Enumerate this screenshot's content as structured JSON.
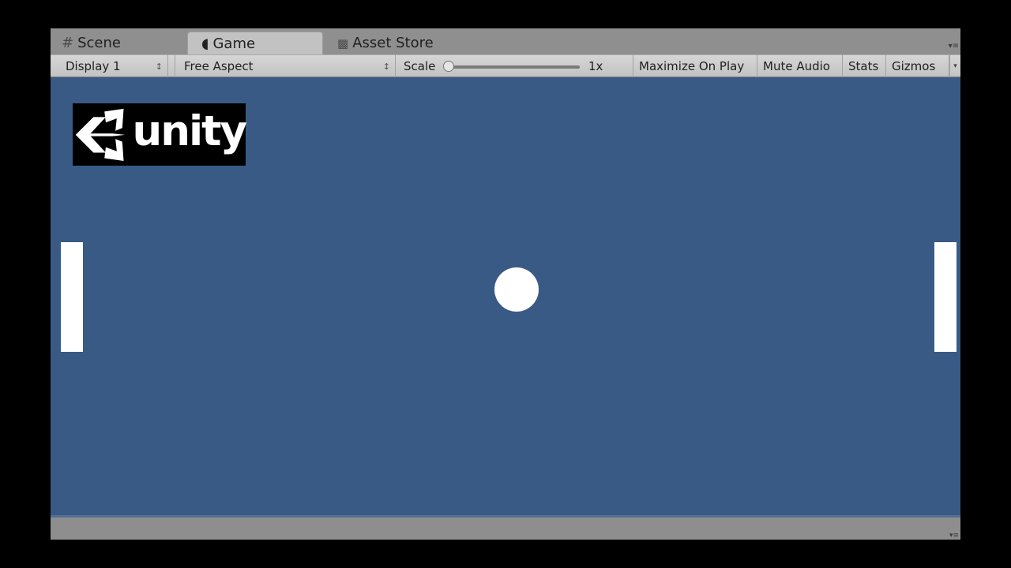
{
  "tabs": [
    {
      "label": "Scene",
      "icon": "grid-icon",
      "glyph": "#"
    },
    {
      "label": "Game",
      "icon": "pacman-icon",
      "glyph": "◖",
      "active": true
    },
    {
      "label": "Asset Store",
      "icon": "store-bag-icon",
      "glyph": "🛍"
    }
  ],
  "tab_menu_glyph": "▾≡",
  "toolbar": {
    "display": {
      "value": "Display 1",
      "arrows": "↕"
    },
    "aspect": {
      "value": "Free Aspect",
      "arrows": "↕"
    },
    "scale": {
      "label": "Scale",
      "value": "1x",
      "fraction": 0.0
    },
    "maximize_on_play": "Maximize On Play",
    "mute_audio": "Mute Audio",
    "stats": "Stats",
    "gizmos": "Gizmos",
    "gizmos_dropdown": "▾"
  },
  "game": {
    "logo_text": "unity",
    "background_color": "#3a5a86",
    "objects": [
      "left-paddle",
      "ball",
      "right-paddle"
    ]
  },
  "status_menu_glyph": "▾≡"
}
